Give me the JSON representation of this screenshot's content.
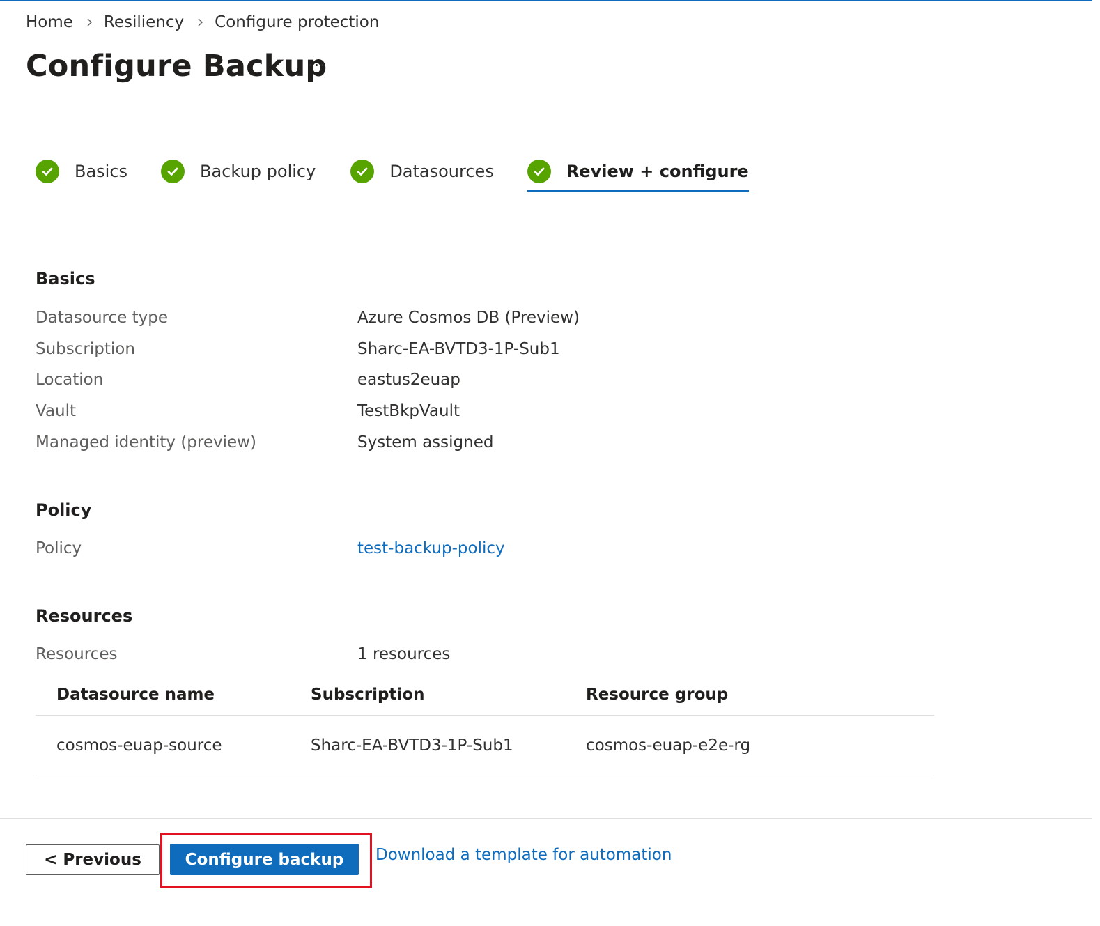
{
  "breadcrumb": [
    "Home",
    "Resiliency",
    "Configure protection"
  ],
  "page": {
    "title": "Configure Backup",
    "more_label": "···"
  },
  "tabs": [
    {
      "label": "Basics",
      "status": "complete"
    },
    {
      "label": "Backup policy",
      "status": "complete"
    },
    {
      "label": "Datasources",
      "status": "complete"
    },
    {
      "label": "Review + configure",
      "status": "complete",
      "active": true
    }
  ],
  "basics": {
    "heading": "Basics",
    "rows": [
      {
        "label": "Datasource type",
        "value": "Azure Cosmos DB (Preview)"
      },
      {
        "label": "Subscription",
        "value": "Sharc-EA-BVTD3-1P-Sub1"
      },
      {
        "label": "Location",
        "value": "eastus2euap"
      },
      {
        "label": "Vault",
        "value": "TestBkpVault"
      },
      {
        "label": "Managed identity (preview)",
        "value": "System assigned"
      }
    ]
  },
  "policy": {
    "heading": "Policy",
    "label": "Policy",
    "value": "test-backup-policy"
  },
  "resources": {
    "heading": "Resources",
    "label": "Resources",
    "count_text": "1 resources",
    "columns": [
      "Datasource name",
      "Subscription",
      "Resource group"
    ],
    "rows": [
      [
        "cosmos-euap-source",
        "Sharc-EA-BVTD3-1P-Sub1",
        "cosmos-euap-e2e-rg"
      ]
    ]
  },
  "footer": {
    "previous_label": "< Previous",
    "configure_label": "Configure backup",
    "template_link": "Download a template for automation"
  },
  "colors": {
    "accent": "#0f6cbd",
    "success": "#57a300",
    "highlight": "#e3101f"
  }
}
